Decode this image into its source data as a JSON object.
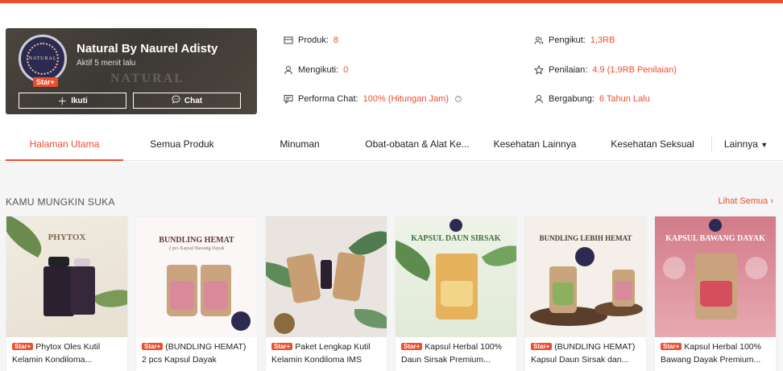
{
  "shop": {
    "name": "Natural By Naurel Adisty",
    "status": "Aktif 5 menit lalu",
    "badge": "Star+",
    "avatar_text": "NATURAL",
    "bg_text": "NATURAL",
    "follow_label": "Ikuti",
    "chat_label": "Chat"
  },
  "stats": {
    "produk_label": "Produk:",
    "produk_value": "8",
    "mengikuti_label": "Mengikuti:",
    "mengikuti_value": "0",
    "performa_label": "Performa Chat:",
    "performa_value": "100% (Hitungan Jam)",
    "pengikut_label": "Pengikut:",
    "pengikut_value": "1,3RB",
    "penilaian_label": "Penilaian:",
    "penilaian_value": "4.9 (1,9RB Penilaian)",
    "bergabung_label": "Bergabung:",
    "bergabung_value": "6 Tahun Lalu"
  },
  "tabs": [
    "Halaman Utama",
    "Semua Produk",
    "Minuman",
    "Obat-obatan & Alat Ke...",
    "Kesehatan Lainnya",
    "Kesehatan Seksual",
    "Lainnya"
  ],
  "recommend": {
    "title": "KAMU MUNGKIN SUKA",
    "more": "Lihat Semua"
  },
  "products": [
    {
      "badge": "Star+",
      "name": "Phytox Oles Kutil Kelamin Kondiloma...",
      "img_text": "PHYTOX"
    },
    {
      "badge": "Star+",
      "name": "(BUNDLING HEMAT) 2 pcs Kapsul Dayak",
      "img_text": "BUNDLING HEMAT",
      "img_sub": "2 pcs Kapsul Bawang Dayak"
    },
    {
      "badge": "Star+",
      "name": "Paket Lengkap Kutil Kelamin Kondiloma IMS",
      "img_text": ""
    },
    {
      "badge": "Star+",
      "name": "Kapsul Herbal 100% Daun Sirsak Premium...",
      "img_text": "KAPSUL DAUN SIRSAK"
    },
    {
      "badge": "Star+",
      "name": "(BUNDLING HEMAT) Kapsul Daun Sirsak dan...",
      "img_text": "BUNDLING LEBIH HEMAT"
    },
    {
      "badge": "Star+",
      "name": "Kapsul Herbal 100% Bawang Dayak Premium...",
      "img_text": "KAPSUL BAWANG DAYAK"
    }
  ],
  "colors": {
    "accent": "#ee4d2d"
  }
}
